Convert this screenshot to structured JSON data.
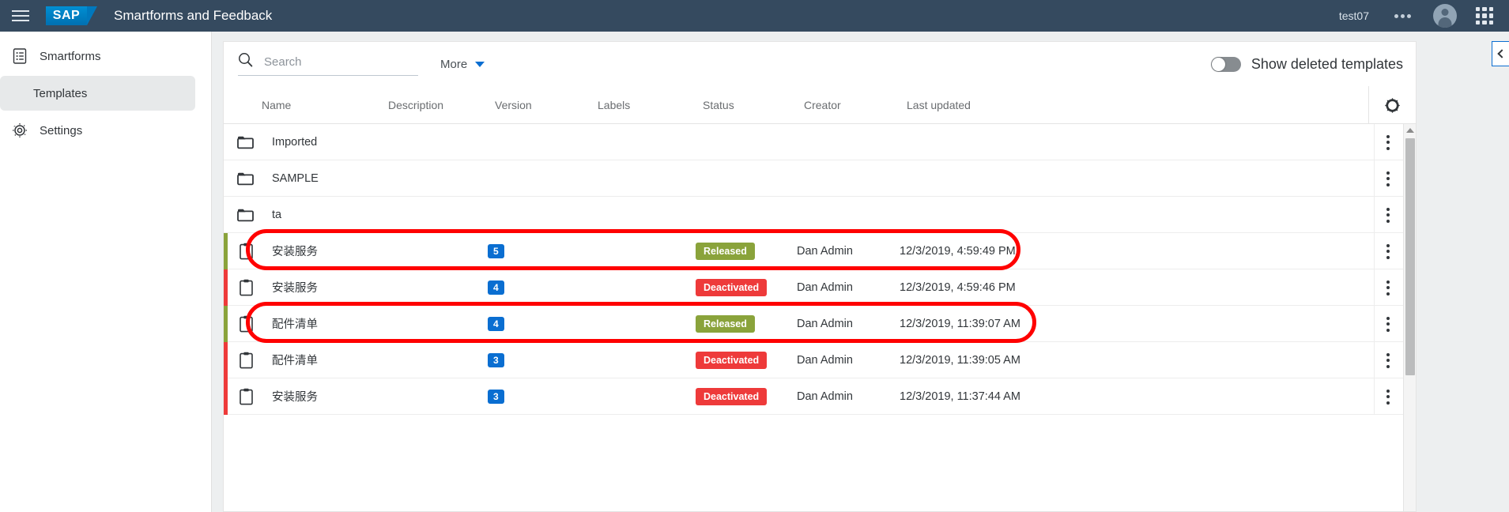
{
  "header": {
    "menu_icon": "hamburger-icon",
    "logo_text": "SAP",
    "title": "Smartforms and Feedback",
    "user": "test07",
    "overflow_icon": "ellipsis-icon",
    "avatar_icon": "user-avatar-icon",
    "apps_icon": "grid-apps-icon",
    "bg_color": "#354a5f"
  },
  "sidebar": {
    "items": [
      {
        "label": "Smartforms",
        "icon": "list-document-icon",
        "active": false,
        "sub": false
      },
      {
        "label": "Templates",
        "icon": "",
        "active": true,
        "sub": true
      },
      {
        "label": "Settings",
        "icon": "gear-icon",
        "active": false,
        "sub": false
      }
    ]
  },
  "toolbar": {
    "search_placeholder": "Search",
    "search_value": "",
    "search_icon": "search-icon",
    "more_label": "More",
    "more_icon": "chevron-down-icon",
    "toggle_label": "Show deleted templates",
    "toggle_on": false,
    "collapse_icon": "chevron-left-icon"
  },
  "table": {
    "columns": [
      "Name",
      "Description",
      "Version",
      "Labels",
      "Status",
      "Creator",
      "Last updated"
    ],
    "settings_icon": "gear-icon",
    "folders": [
      {
        "name": "Imported",
        "icon": "folder-icon"
      },
      {
        "name": "SAMPLE",
        "icon": "folder-icon"
      },
      {
        "name": "ta",
        "icon": "folder-icon"
      }
    ],
    "templates": [
      {
        "name": "安装服务",
        "description": "",
        "version": "5",
        "labels": "",
        "status": "Released",
        "status_kind": "released",
        "creator": "Dan Admin",
        "last_updated": "12/3/2019, 4:59:49 PM",
        "bar_color": "#8aa33b",
        "icon": "clipboard-icon",
        "highlighted": true
      },
      {
        "name": "安装服务",
        "description": "",
        "version": "4",
        "labels": "",
        "status": "Deactivated",
        "status_kind": "deactivated",
        "creator": "Dan Admin",
        "last_updated": "12/3/2019, 4:59:46 PM",
        "bar_color": "#ee3a3a",
        "icon": "clipboard-icon",
        "highlighted": false
      },
      {
        "name": "配件清单",
        "description": "",
        "version": "4",
        "labels": "",
        "status": "Released",
        "status_kind": "released",
        "creator": "Dan Admin",
        "last_updated": "12/3/2019, 11:39:07 AM",
        "bar_color": "#8aa33b",
        "icon": "clipboard-icon",
        "highlighted": true
      },
      {
        "name": "配件清单",
        "description": "",
        "version": "3",
        "labels": "",
        "status": "Deactivated",
        "status_kind": "deactivated",
        "creator": "Dan Admin",
        "last_updated": "12/3/2019, 11:39:05 AM",
        "bar_color": "#ee3a3a",
        "icon": "clipboard-icon",
        "highlighted": false
      },
      {
        "name": "安装服务",
        "description": "",
        "version": "3",
        "labels": "",
        "status": "Deactivated",
        "status_kind": "deactivated",
        "creator": "Dan Admin",
        "last_updated": "12/3/2019, 11:37:44 AM",
        "bar_color": "#ee3a3a",
        "icon": "clipboard-icon",
        "highlighted": false
      }
    ],
    "row_menu_icon": "kebab-menu-icon"
  },
  "colors": {
    "accent_blue": "#0a6ed1",
    "released_green": "#8aa33b",
    "deactivated_red": "#ee3a3a",
    "annotation_red": "#ff0000"
  }
}
